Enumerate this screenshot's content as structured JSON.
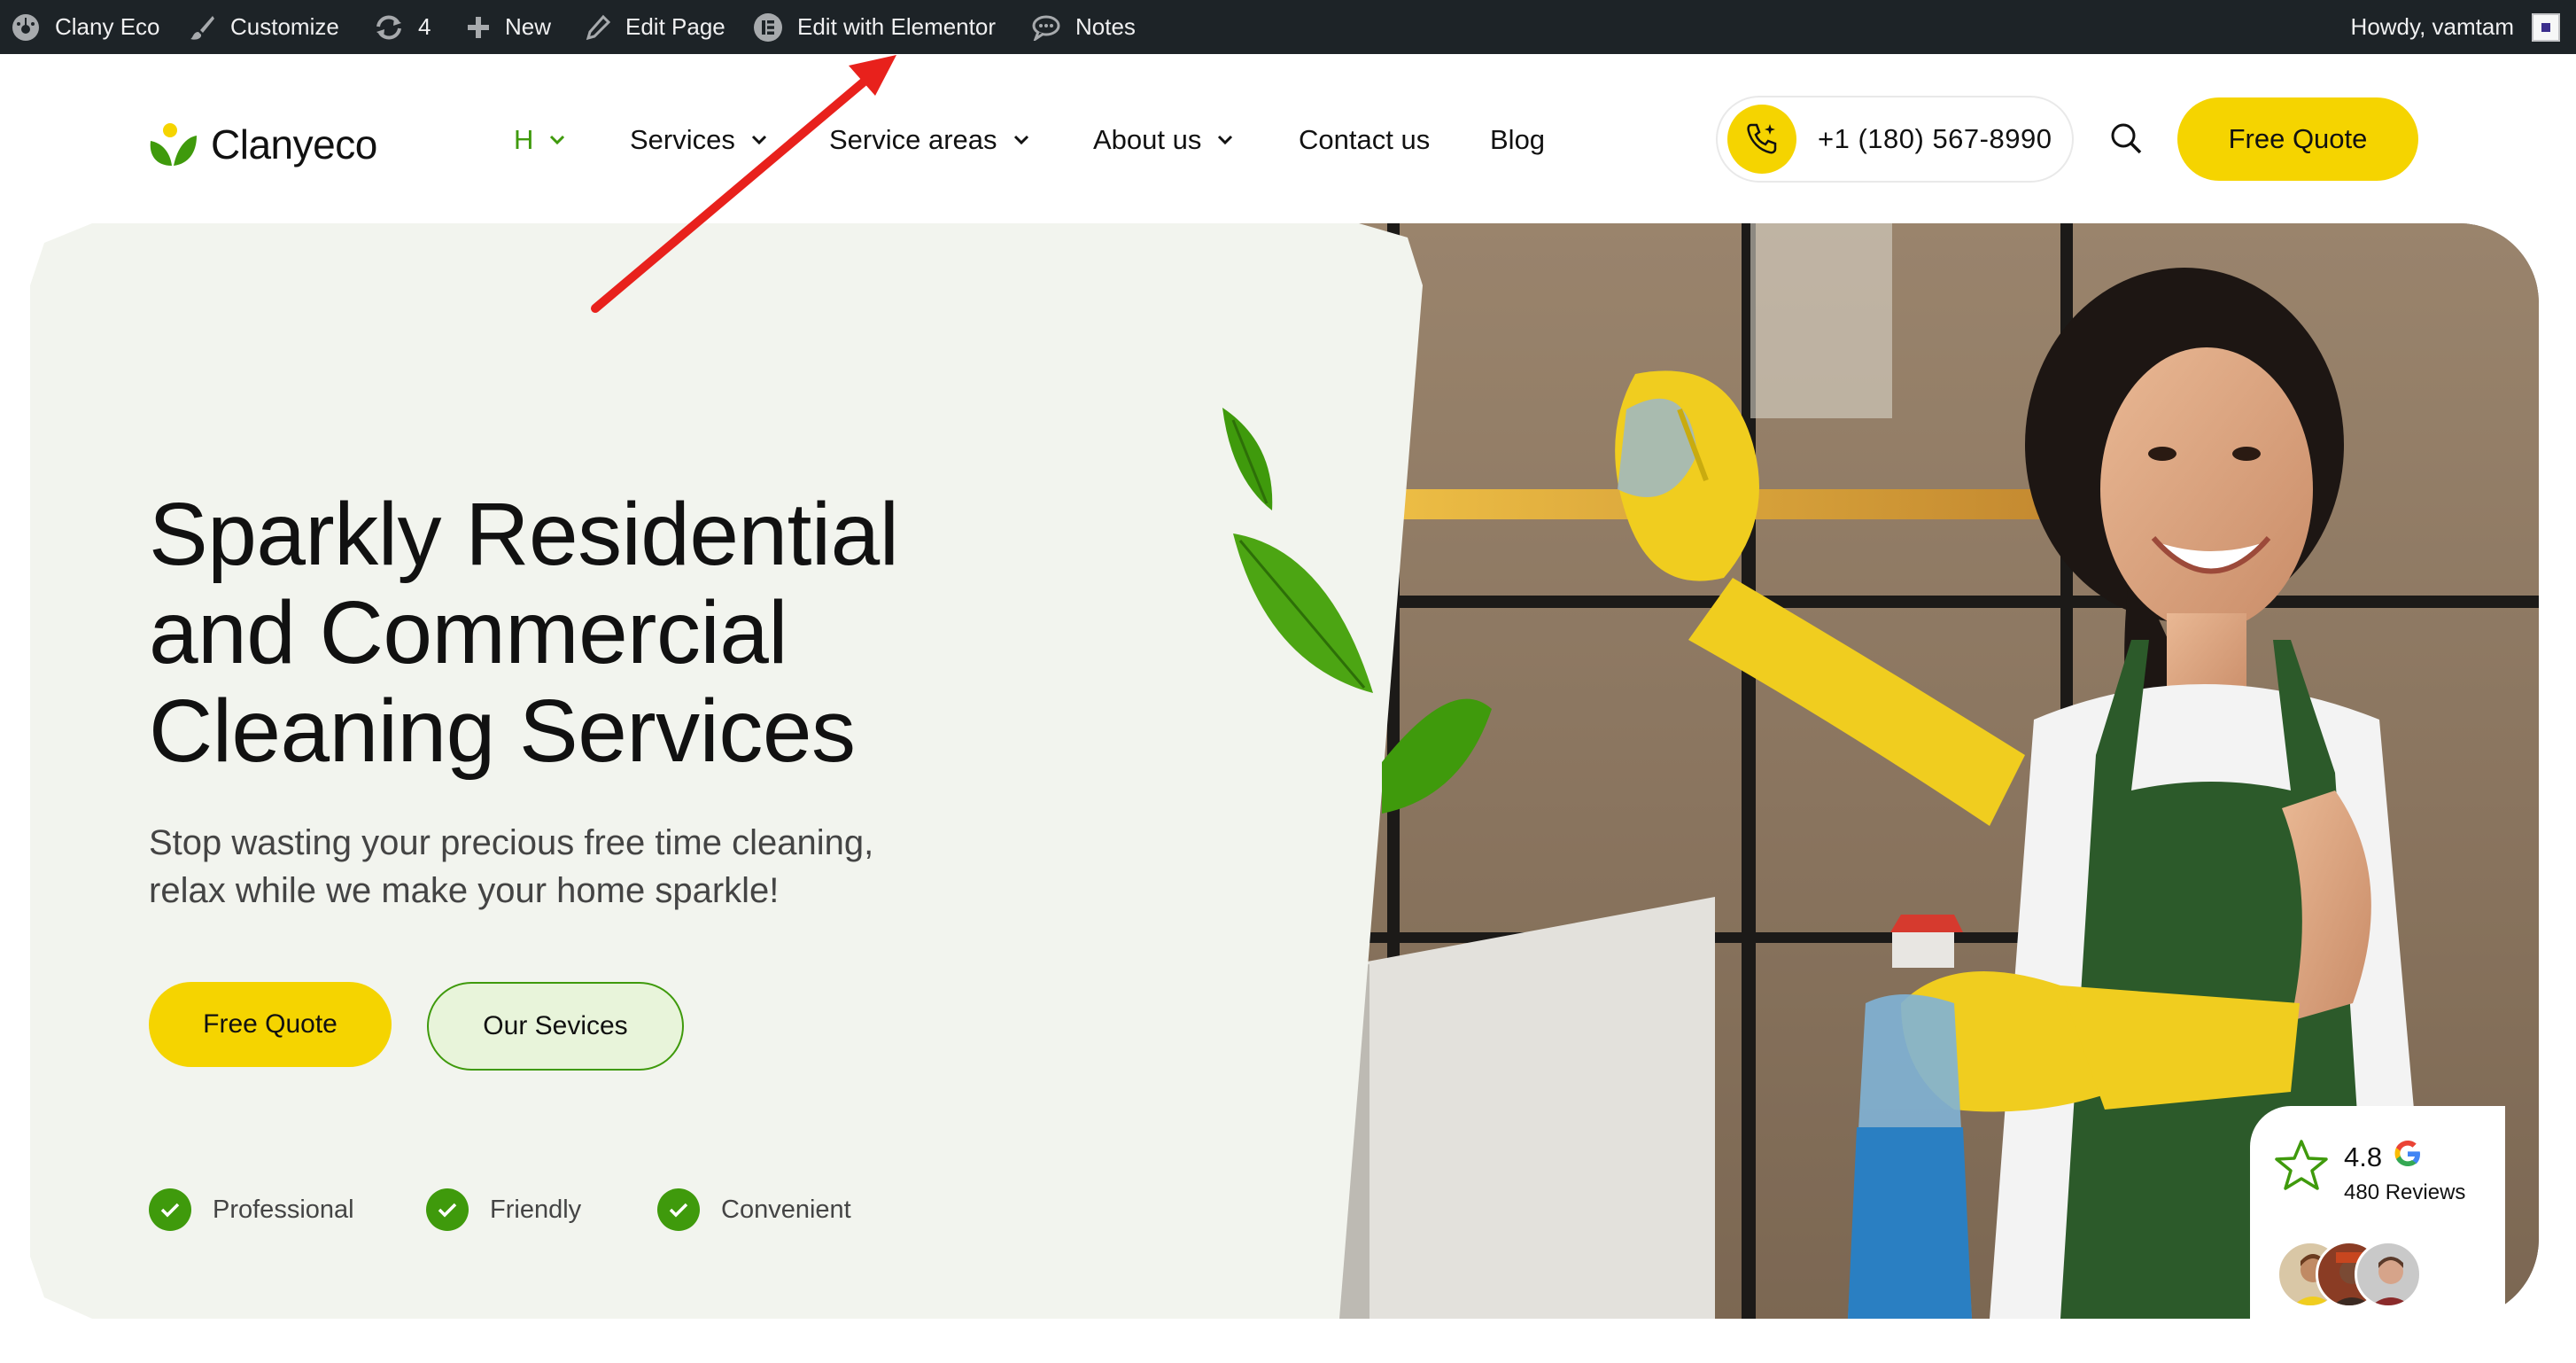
{
  "admin_bar": {
    "site_name": "Clany Eco",
    "customize": "Customize",
    "updates_count": "4",
    "new": "New",
    "edit_page": "Edit Page",
    "edit_elementor": "Edit with Elementor",
    "notes": "Notes",
    "howdy": "Howdy, vamtam"
  },
  "header": {
    "logo_text": "Clanyeco",
    "nav": [
      {
        "label": "H",
        "has_dropdown": true,
        "active": true
      },
      {
        "label": "Services",
        "has_dropdown": true
      },
      {
        "label": "Service areas",
        "has_dropdown": true
      },
      {
        "label": "About us",
        "has_dropdown": true
      },
      {
        "label": "Contact us",
        "has_dropdown": false
      },
      {
        "label": "Blog",
        "has_dropdown": false
      }
    ],
    "phone": "+1 (180) 567-8990",
    "cta": "Free Quote"
  },
  "hero": {
    "title_lines": [
      "Sparkly Residential",
      "and Commercial",
      "Cleaning Services"
    ],
    "subtitle_lines": [
      "Stop wasting your precious free time cleaning,",
      "relax while we make your home sparkle!"
    ],
    "primary_button": "Free Quote",
    "secondary_button": "Our Sevices",
    "features": [
      "Professional",
      "Friendly",
      "Convenient"
    ]
  },
  "rating": {
    "score": "4.8",
    "reviews": "480 Reviews"
  },
  "colors": {
    "accent_yellow": "#f5d400",
    "accent_green": "#3f9a0c",
    "admin_bar": "#1d2327",
    "panel": "#f2f4ee",
    "annotation_arrow": "#e8211c"
  }
}
